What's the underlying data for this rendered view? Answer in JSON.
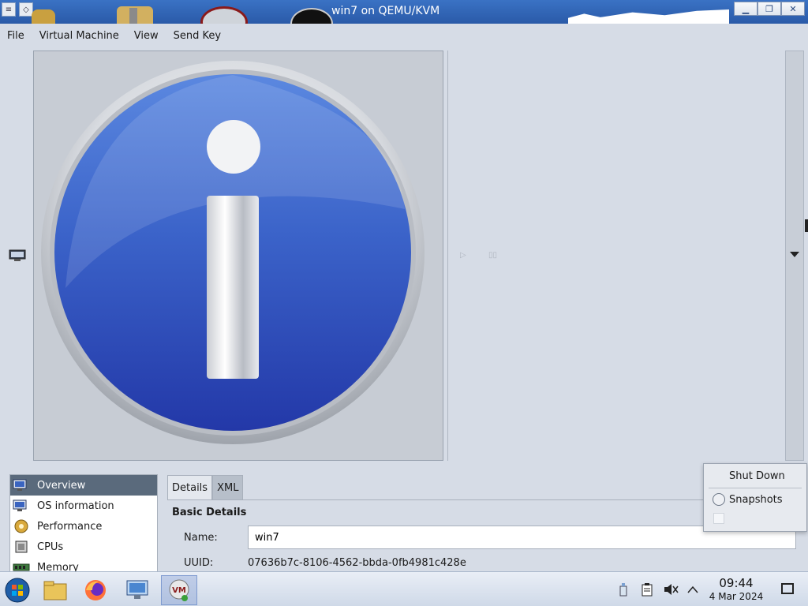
{
  "window": {
    "title": "win7 on QEMU/KVM",
    "controls": [
      "minimize",
      "maximize",
      "close"
    ]
  },
  "menubar": {
    "items": [
      "File",
      "Virtual Machine",
      "View",
      "Send Key"
    ]
  },
  "console": {
    "image": "info-icon"
  },
  "details": {
    "nav": [
      {
        "label": "Overview",
        "icon": "overview-icon",
        "selected": true
      },
      {
        "label": "OS information",
        "icon": "os-info-icon"
      },
      {
        "label": "Performance",
        "icon": "performance-icon"
      },
      {
        "label": "CPUs",
        "icon": "cpu-icon"
      },
      {
        "label": "Memory",
        "icon": "memory-icon"
      }
    ],
    "tabs": [
      {
        "label": "Details",
        "active": true
      },
      {
        "label": "XML",
        "active": false
      }
    ],
    "section_title": "Basic Details",
    "name_label": "Name:",
    "name_value": "win7",
    "uuid_label": "UUID:",
    "uuid_value": "07636b7c-8106-4562-bbda-0fb4981c428e"
  },
  "popup": {
    "shut_down": "Shut Down",
    "snapshots": "Snapshots"
  },
  "taskbar": {
    "apps": [
      "start-orb-icon",
      "file-explorer-icon",
      "firefox-icon",
      "remote-desktop-icon",
      "virt-manager-icon"
    ],
    "tray": [
      "usb-icon",
      "clipboard-icon",
      "volume-muted-icon",
      "chevron-up-icon"
    ],
    "time": "09:44",
    "date": "4 Mar 2024"
  },
  "colors": {
    "titlebar": "#2a5aa8",
    "selection": "#5a6a7c",
    "background": "#d6dce6"
  }
}
